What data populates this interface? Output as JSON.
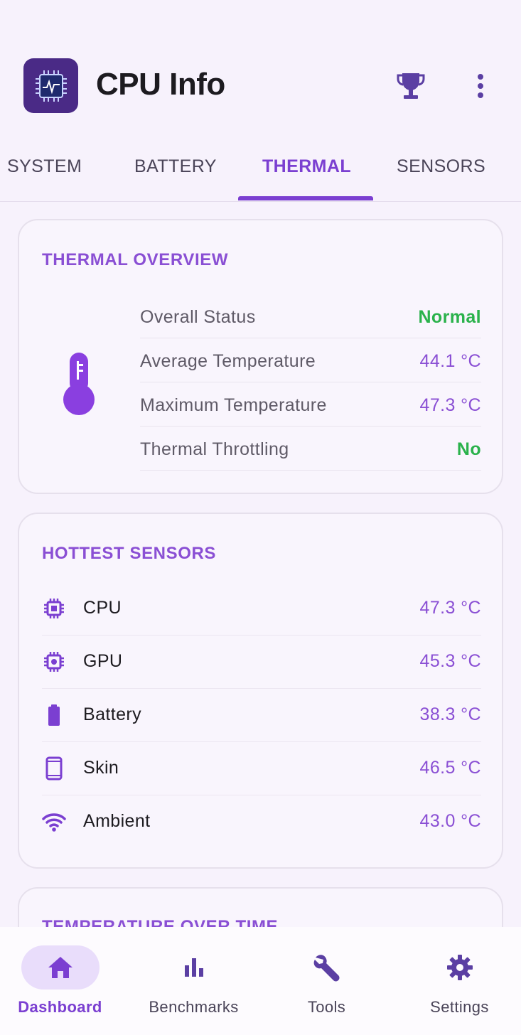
{
  "app": {
    "title": "CPU Info"
  },
  "tabs": [
    {
      "label": "SYSTEM"
    },
    {
      "label": "BATTERY"
    },
    {
      "label": "THERMAL"
    },
    {
      "label": "SENSORS"
    }
  ],
  "thermal_overview": {
    "title": "THERMAL OVERVIEW",
    "rows": [
      {
        "label": "Overall Status",
        "value": "Normal"
      },
      {
        "label": "Average Temperature",
        "value": "44.1 °C"
      },
      {
        "label": "Maximum Temperature",
        "value": "47.3 °C"
      },
      {
        "label": "Thermal Throttling",
        "value": "No"
      }
    ]
  },
  "hottest_sensors": {
    "title": "HOTTEST SENSORS",
    "rows": [
      {
        "icon": "cpu-chip-icon",
        "label": "CPU",
        "value": "47.3 °C"
      },
      {
        "icon": "gpu-chip-icon",
        "label": "GPU",
        "value": "45.3 °C"
      },
      {
        "icon": "battery-icon",
        "label": "Battery",
        "value": "38.3 °C"
      },
      {
        "icon": "phone-icon",
        "label": "Skin",
        "value": "46.5 °C"
      },
      {
        "icon": "wifi-icon",
        "label": "Ambient",
        "value": "43.0 °C"
      }
    ]
  },
  "next_card": {
    "title": "TEMPERATURE OVER TIME"
  },
  "bottom_nav": [
    {
      "label": "Dashboard",
      "icon": "home-icon"
    },
    {
      "label": "Benchmarks",
      "icon": "bar-chart-icon"
    },
    {
      "label": "Tools",
      "icon": "wrench-icon"
    },
    {
      "label": "Settings",
      "icon": "gear-icon"
    }
  ],
  "colors": {
    "accent": "#7b3fd1",
    "title_purple": "#8a4fd4",
    "good_green": "#2bb24c",
    "background": "#f7f2fc"
  }
}
